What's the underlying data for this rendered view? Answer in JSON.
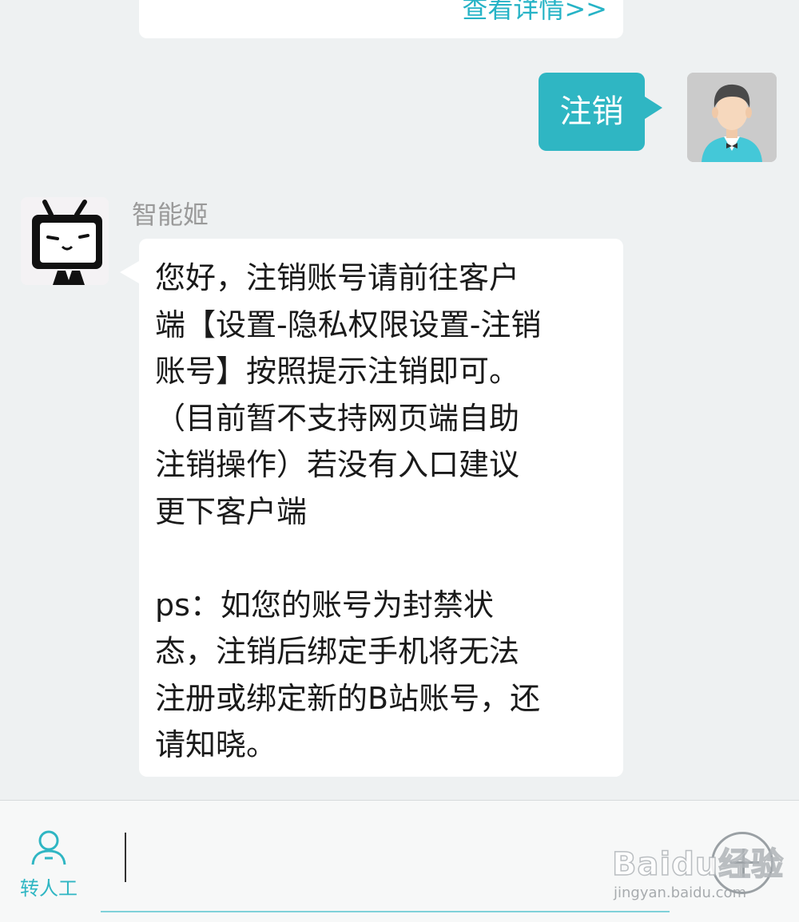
{
  "previous_card": {
    "detail_link": "查看详情>>"
  },
  "user_message": {
    "text": "注销"
  },
  "bot": {
    "name": "智能姬",
    "message_lines": [
      "您好，注销账号请前往客户",
      "端【设置-隐私权限设置-注销",
      "账号】按照提示注销即可。",
      "（目前暂不支持网页端自助",
      "注销操作）若没有入口建议",
      "更下客户端",
      "",
      "ps：如您的账号为封禁状",
      "态，注销后绑定手机将无法",
      "注册或绑定新的B站账号，还",
      "请知晓。"
    ]
  },
  "input_bar": {
    "transfer_label": "转人工",
    "input_value": "",
    "transfer_icon": "person-icon",
    "plus_icon": "plus-circle-icon"
  },
  "watermark": {
    "brand": "Baidu经验",
    "url": "jingyan.baidu.com"
  },
  "colors": {
    "accent": "#2fb6c3",
    "background": "#eef1f2",
    "bubble": "#ffffff",
    "link": "#26b3c6"
  }
}
